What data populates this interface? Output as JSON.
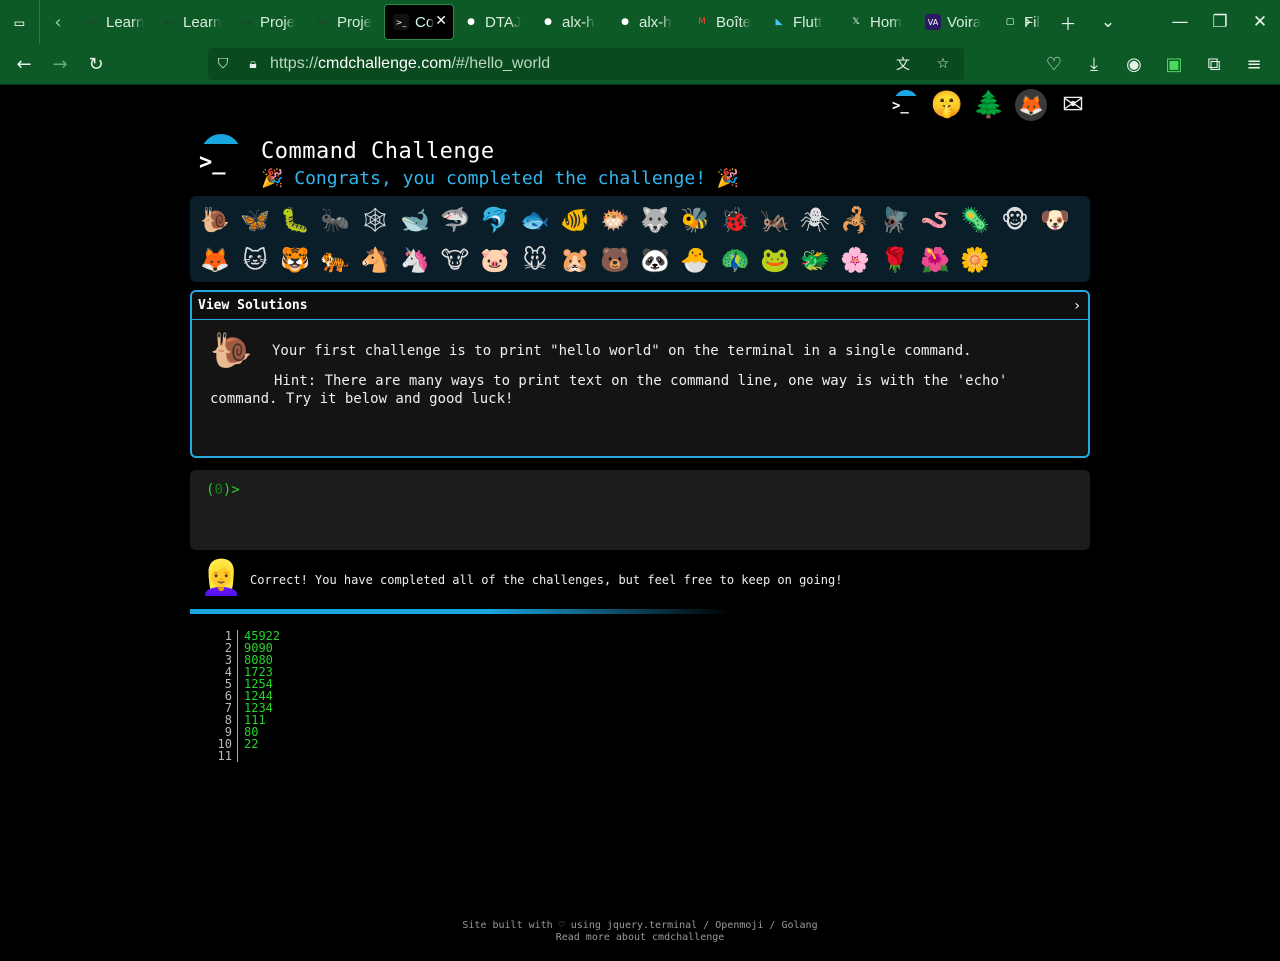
{
  "browser": {
    "tabs": [
      {
        "favicon": "alx",
        "label": "Learn"
      },
      {
        "favicon": "alx",
        "label": "Learn"
      },
      {
        "favicon": "alx",
        "label": "Proje"
      },
      {
        "favicon": "alx",
        "label": "Proje"
      },
      {
        "favicon": ">_",
        "label": "Co",
        "active": true
      },
      {
        "favicon": "github",
        "label": "DTAJ"
      },
      {
        "favicon": "github",
        "label": "alx-h"
      },
      {
        "favicon": "github",
        "label": "alx-h"
      },
      {
        "favicon": "M",
        "label": "Boîte"
      },
      {
        "favicon": "flutter",
        "label": "Flutt"
      },
      {
        "favicon": "X",
        "label": "Hom"
      },
      {
        "favicon": "VA",
        "label": "Voira"
      },
      {
        "favicon": "box",
        "label": "Fil"
      }
    ],
    "url_prefix": "https://",
    "url_host": "cmdchallenge.com",
    "url_path": "/#/hello_world",
    "theme_color": "#0d5a26"
  },
  "site": {
    "top_icons": [
      "terminal-icon",
      "shushing-face-icon",
      "tree-icon",
      "gitlab-icon",
      "envelope-icon"
    ],
    "title": "Command Challenge",
    "subtitle": "🎉 Congrats, you completed the challenge! 🎉",
    "accent": "#27a9df"
  },
  "badges": [
    "🐌",
    "🦋",
    "🐛",
    "🐜",
    "🕸",
    "🐋",
    "🦈",
    "🐬",
    "🐟",
    "🐠",
    "🐡",
    "🐺",
    "🐝",
    "🐞",
    "🦗",
    "🕷",
    "🦂",
    "🪰",
    "🪱",
    "🦠",
    "🐵",
    "🐶",
    "🦊",
    "🐱",
    "🐯",
    "🐅",
    "🐴",
    "🦄",
    "🐮",
    "🐷",
    "🐭",
    "🐹",
    "🐻",
    "🐼",
    "🐣",
    "🦚",
    "🐸",
    "🐲",
    "🌸",
    "🌹",
    "🌺",
    "🌼"
  ],
  "challenge": {
    "header": "View Solutions",
    "text": "Your first challenge is to print \"hello world\" on the terminal in a single command.",
    "hint": "Hint: There are many ways to print text on the command line, one way is with the 'echo' command. Try it below and good luck!"
  },
  "terminal": {
    "prompt_open": "(",
    "prompt_count": "0",
    "prompt_close": ")>"
  },
  "result": {
    "message": "Correct! You have completed all of the challenges, but feel free to keep on going!"
  },
  "output": {
    "line_numbers": [
      "1",
      "2",
      "3",
      "4",
      "5",
      "6",
      "7",
      "8",
      "9",
      "10",
      "11"
    ],
    "lines": [
      "45922",
      "9090",
      "8080",
      "1723",
      "1254",
      "1244",
      "1234",
      "111",
      "80",
      "22",
      ""
    ]
  },
  "footer": {
    "line1": "Site built with ♡ using jquery.terminal / Openmoji / Golang",
    "line2": "Read more about cmdchallenge"
  }
}
